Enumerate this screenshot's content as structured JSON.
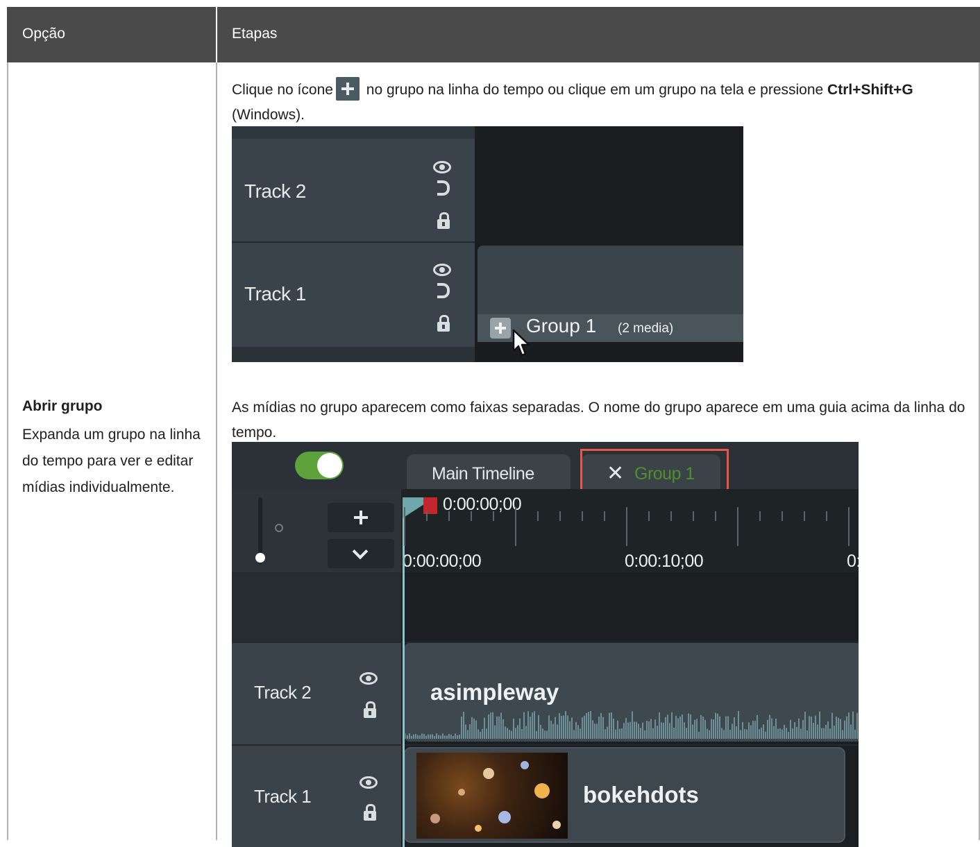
{
  "table": {
    "header": {
      "col1": "Opção",
      "col2": "Etapas"
    }
  },
  "option": {
    "title": "Abrir grupo",
    "description": "Expanda um grupo na linha do tempo para ver e editar mídias individualmente."
  },
  "steps": {
    "p1_before_icon": "Clique no ícone",
    "p1_after_icon": " no grupo na linha do tempo ou clique em um grupo na tela e pressione ",
    "p1_shortcut": "Ctrl+Shift+G",
    "p1_tail": " (Windows).",
    "p2": "As mídias no grupo aparecem como faixas separadas. O nome do grupo aparece em uma guia acima da linha do tempo."
  },
  "screenshot1": {
    "track2_label": "Track 2",
    "track1_label": "Track 1",
    "group_name": "Group 1",
    "group_count": "(2 media)"
  },
  "screenshot2": {
    "tab_main": "Main Timeline",
    "tab_group": "Group 1",
    "tab_close": "✕",
    "current_time": "0:00:00;00",
    "ruler_labels": [
      "0:00:00;00",
      "0:00:10;00",
      "0:"
    ],
    "track2_label": "Track 2",
    "track1_label": "Track 1",
    "audio_clip": "asimpleway",
    "video_clip": "bokehdots",
    "colors": {
      "toggle": "#5da23a",
      "highlight": "#e8574b",
      "group_tab_text": "#4f8f2c",
      "playhead": "#c3262c"
    }
  }
}
